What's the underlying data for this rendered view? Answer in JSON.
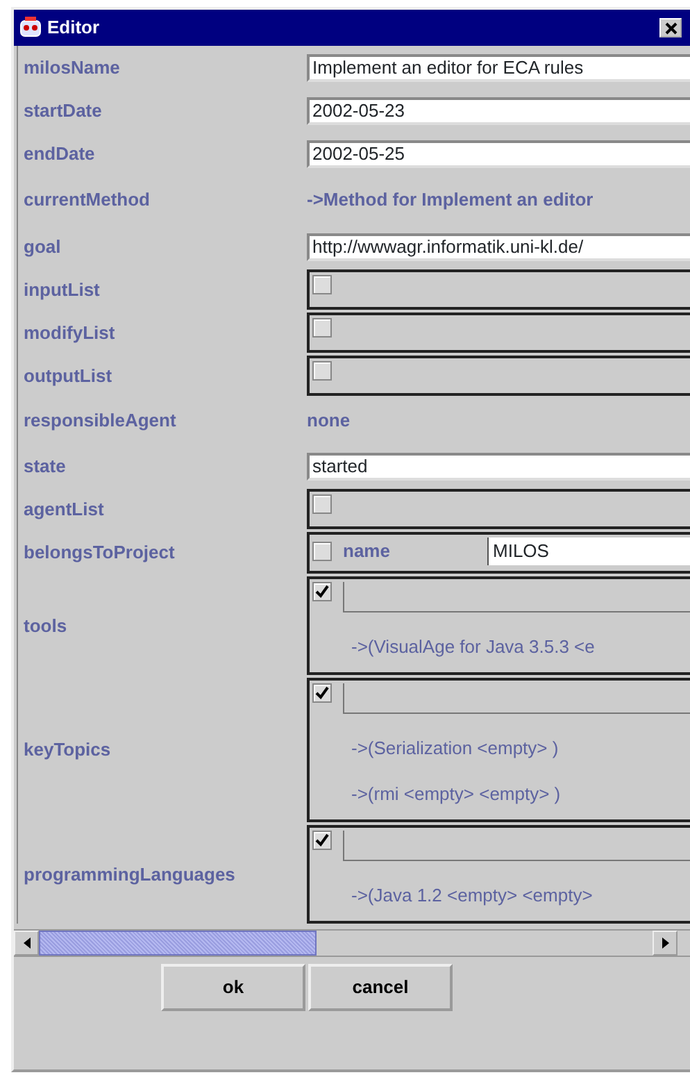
{
  "window": {
    "title": "Editor"
  },
  "fields": [
    {
      "label": "milosName",
      "kind": "text",
      "value": "Implement an editor for ECA rules"
    },
    {
      "label": "startDate",
      "kind": "text",
      "value": "2002-05-23"
    },
    {
      "label": "endDate",
      "kind": "text",
      "value": "2002-05-25"
    },
    {
      "label": "currentMethod",
      "kind": "reference",
      "value": "->Method for Implement an editor"
    },
    {
      "label": "goal",
      "kind": "text",
      "value": "http://wwwagr.informatik.uni-kl.de/"
    },
    {
      "label": "inputList",
      "kind": "list",
      "checked": false
    },
    {
      "label": "modifyList",
      "kind": "list",
      "checked": false
    },
    {
      "label": "outputList",
      "kind": "list",
      "checked": false
    },
    {
      "label": "responsibleAgent",
      "kind": "plain",
      "value": "none"
    },
    {
      "label": "state",
      "kind": "text",
      "value": "started"
    },
    {
      "label": "agentList",
      "kind": "list",
      "checked": false
    },
    {
      "label": "belongsToProject",
      "kind": "object",
      "checked": false,
      "subfields": [
        {
          "label": "name",
          "value": "MILOS"
        }
      ]
    },
    {
      "label": "tools",
      "kind": "list",
      "checked": true,
      "items": [
        "->(VisualAge for Java 3.5.3 <e"
      ]
    },
    {
      "label": "keyTopics",
      "kind": "list",
      "checked": true,
      "items": [
        "->(Serialization <empty> )",
        "->(rmi <empty> <empty> )"
      ]
    },
    {
      "label": "programmingLanguages",
      "kind": "list",
      "checked": true,
      "items": [
        "->(Java 1.2 <empty> <empty>"
      ]
    }
  ],
  "buttons": [
    "ok",
    "cancel"
  ]
}
